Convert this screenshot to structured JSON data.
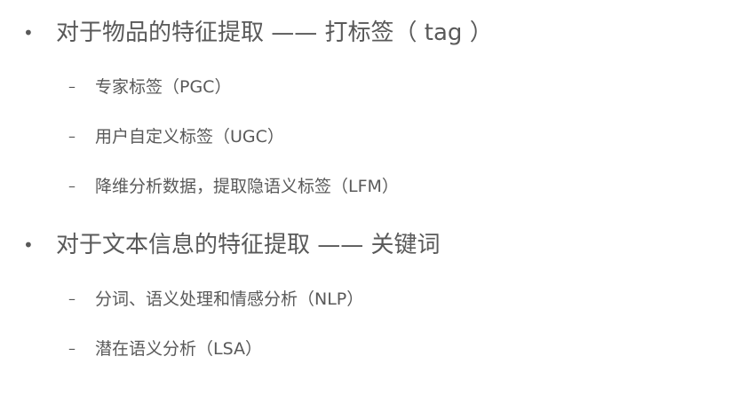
{
  "sections": [
    {
      "bullet": "•",
      "title": "对于物品的特征提取 —— 打标签（ tag ）",
      "items": [
        {
          "marker": "–",
          "text": "专家标签（PGC）"
        },
        {
          "marker": "–",
          "text": "用户自定义标签（UGC）"
        },
        {
          "marker": "–",
          "text": "降维分析数据，提取隐语义标签（LFM）"
        }
      ]
    },
    {
      "bullet": "•",
      "title": "对于文本信息的特征提取 —— 关键词",
      "items": [
        {
          "marker": "–",
          "text": "分词、语义处理和情感分析（NLP）"
        },
        {
          "marker": "–",
          "text": "潜在语义分析（LSA）"
        }
      ]
    }
  ]
}
